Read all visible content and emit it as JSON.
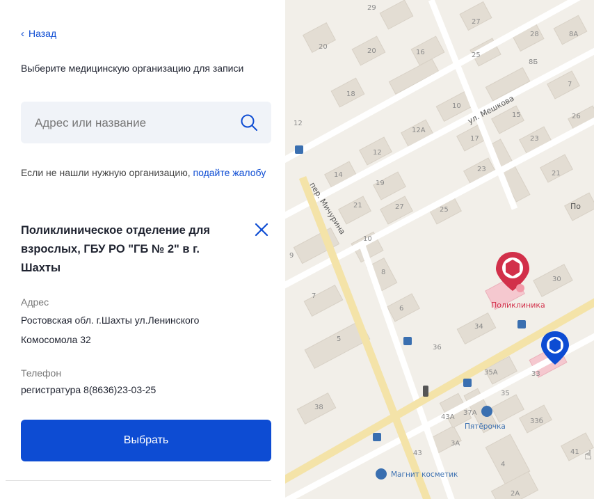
{
  "nav": {
    "back_label": "Назад"
  },
  "prompt": "Выберите медицинскую организацию для записи",
  "search": {
    "placeholder": "Адрес или название",
    "value": ""
  },
  "not_found": {
    "text": "Если не нашли нужную организацию,",
    "link": "подайте жалобу"
  },
  "organization": {
    "name": "Поликлиническое отделение для взрослых, ГБУ РО \"ГБ № 2\" в г. Шахты",
    "address_label": "Адрес",
    "address": "Ростовская обл. г.Шахты ул.Ленинского Комосомола 32",
    "phone_label": "Телефон",
    "phone": "регистратура 8(8636)23-03-25"
  },
  "select_button": "Выбрать",
  "map": {
    "streets": [
      "пер. Мичурина",
      "ул. Мешкова",
      "По"
    ],
    "selected_poi": "Поликлиника",
    "pois": [
      "Пятёрочка",
      "Магнит косметик"
    ],
    "house_numbers": [
      "29",
      "27",
      "28",
      "8А",
      "20",
      "20",
      "16",
      "25",
      "8Б",
      "18",
      "10",
      "15",
      "7",
      "26",
      "12",
      "12А",
      "17",
      "23",
      "12",
      "23",
      "21",
      "14",
      "19",
      "21",
      "27",
      "25",
      "10",
      "8",
      "30",
      "7",
      "6",
      "34",
      "5",
      "36",
      "35А",
      "33",
      "35",
      "38",
      "43А",
      "37А",
      "33б",
      "43",
      "3А",
      "4",
      "41",
      "2А",
      "9"
    ],
    "colors": {
      "selected_marker": "#d2304a",
      "other_marker": "#0d4cd3",
      "accent": "#0d4cd3"
    }
  },
  "icons": {
    "search": "search-icon",
    "close": "close-icon",
    "back": "chevron-left-icon"
  }
}
